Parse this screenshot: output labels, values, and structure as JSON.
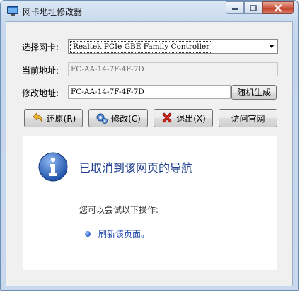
{
  "window": {
    "title": "网卡地址修改器"
  },
  "form": {
    "adapter_label": "选择网卡:",
    "adapter_value": "Realtek PCIe GBE Family Controller",
    "current_label": "当前地址:",
    "current_value": "FC-AA-14-7F-4F-7D",
    "modify_label": "修改地址:",
    "modify_value": "FC-AA-14-7F-4F-7D",
    "random_button": "随机生成"
  },
  "actions": {
    "restore": "还原(R)",
    "modify": "修改(C)",
    "exit": "退出(X)",
    "website": "访问官网"
  },
  "browser": {
    "title": "已取消到该网页的导航",
    "subtitle": "您可以尝试以下操作:",
    "link": "刷新该页面。"
  },
  "colors": {
    "accent": "#1f3f8c",
    "link": "#1d46a8"
  },
  "icons": {
    "app": "network-card-icon",
    "restore": "undo-arrow-icon",
    "modify": "gear-icon",
    "exit": "red-x-icon",
    "info": "info-icon",
    "bullet": "bullet-icon"
  }
}
